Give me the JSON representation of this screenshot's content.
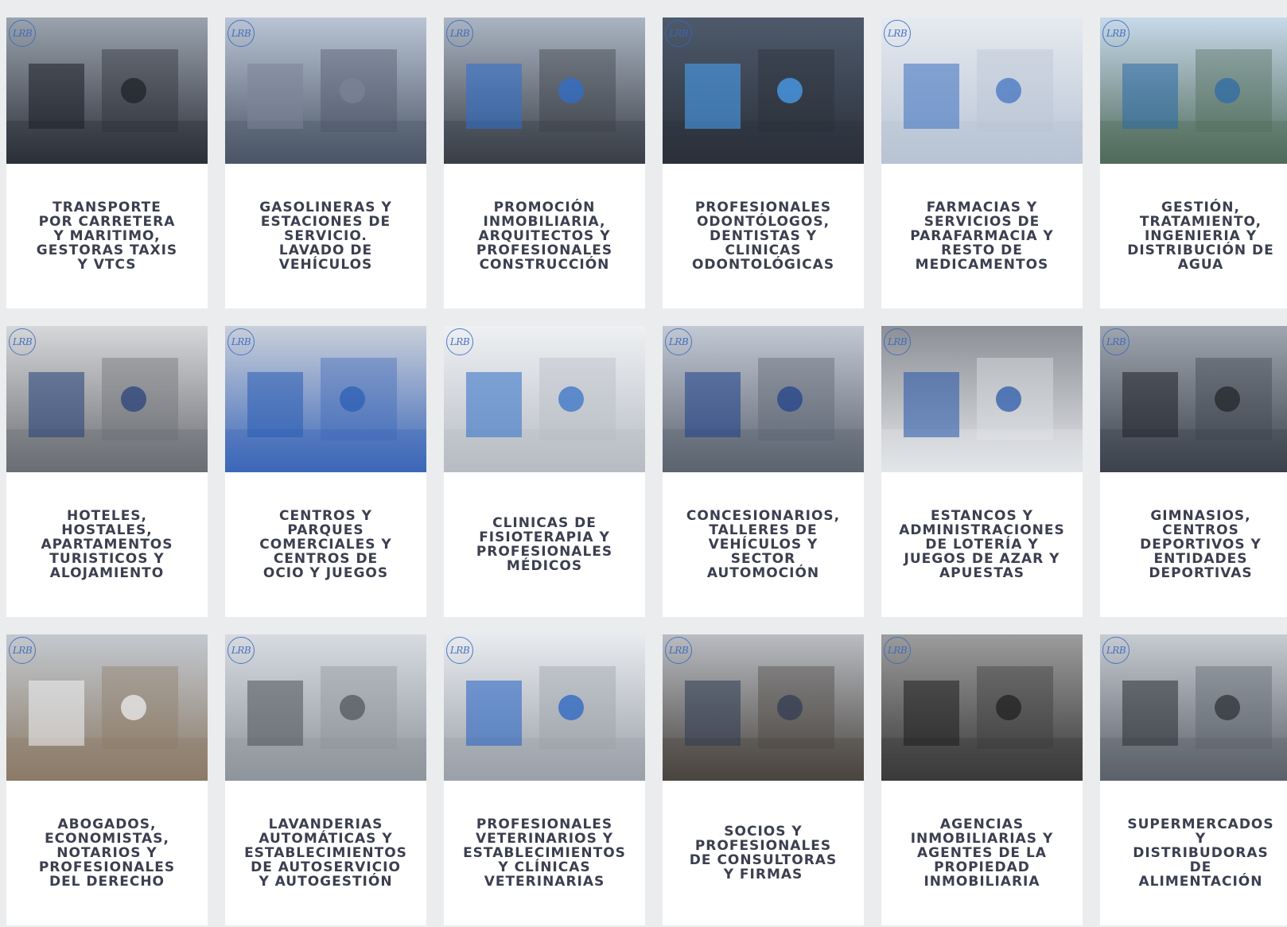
{
  "brand_mark": "LRB",
  "cards": [
    {
      "title": "TRANSPORTE\nPOR CARRETERA\nY MARITIMO,\nGESTORAS TAXIS\nY VTCS",
      "icon": "taxi-app-photo",
      "c1": "#9aa3ae",
      "c2": "#2c3038",
      "acc": "#1c1f26"
    },
    {
      "title": "GASOLINERAS Y\nESTACIONES DE\nSERVICIO.\nLAVADO DE\nVEHÍCULOS",
      "icon": "gas-station-photo",
      "c1": "#b9c4d4",
      "c2": "#4b5566",
      "acc": "#7b8597"
    },
    {
      "title": "PROMOCIÓN\nINMOBILIARIA,\nARQUITECTOS Y\nPROFESIONALES\nCONSTRUCCIÓN",
      "icon": "construction-site-photo",
      "c1": "#aab4c2",
      "c2": "#3a3f47",
      "acc": "#2d6fd0"
    },
    {
      "title": "PROFESIONALES\nODONTÓLOGOS,\nDENTISTAS Y\nCLINICAS\nODONTOLÓGICAS",
      "icon": "dental-clinic-photo",
      "c1": "#4e5a6b",
      "c2": "#2a303a",
      "acc": "#4aa8ff"
    },
    {
      "title": "FARMACIAS Y\nSERVICIOS DE\nPARAFARMACIA Y\nRESTO DE\nMEDICAMENTOS",
      "icon": "pharmacy-photo",
      "c1": "#e6eaf0",
      "c2": "#b8c4d4",
      "acc": "#3a6fbf"
    },
    {
      "title": "GESTIÓN,\nTRATAMIENTO,\nINGENIERIA Y\nDISTRIBUCIÓN DE\nAGUA",
      "icon": "water-dam-photo",
      "c1": "#c7d9ea",
      "c2": "#4f6b5a",
      "acc": "#2a6aa8"
    },
    {
      "title": "HOTELES,\nHOSTALES,\nAPARTAMENTOS\nTURISTICOS Y\nALOJAMIENTO",
      "icon": "hotel-room-photo",
      "c1": "#d6d7d9",
      "c2": "#6b6e74",
      "acc": "#243f7a"
    },
    {
      "title": "CENTROS Y\nPARQUES\nCOMERCIALES Y\nCENTROS DE\nOCIO Y JUEGOS",
      "icon": "playground-photo",
      "c1": "#c9cfda",
      "c2": "#3b67b8",
      "acc": "#2a5cb4"
    },
    {
      "title": "CLINICAS DE\nFISIOTERAPIA Y\nPROFESIONALES\nMÉDICOS",
      "icon": "physiotherapy-photo",
      "c1": "#eef0f3",
      "c2": "#b7bcc4",
      "acc": "#2e6ec8"
    },
    {
      "title": "CONCESIONARIOS,\nTALLERES DE\nVEHÍCULOS Y\nSECTOR\nAUTOMOCIÓN",
      "icon": "car-dealership-photo",
      "c1": "#c2c9d4",
      "c2": "#5c6370",
      "acc": "#1e3f8c"
    },
    {
      "title": "ESTANCOS Y\nADMINISTRACIONES\nDE LOTERÍA Y\nJUEGOS DE AZAR Y\nAPUESTAS",
      "icon": "tobacco-shop-photo",
      "c1": "#8c8f95",
      "c2": "#e3e5e9",
      "acc": "#2153a8"
    },
    {
      "title": "GIMNASIOS,\nCENTROS\nDEPORTIVOS Y\nENTIDADES\nDEPORTIVAS",
      "icon": "gym-photo",
      "c1": "#9fa6b0",
      "c2": "#3d434c",
      "acc": "#1f2329"
    },
    {
      "title": "ABOGADOS,\nECONOMISTAS,\nNOTARIOS Y\nPROFESIONALES\nDEL DERECHO",
      "icon": "office-documents-photo",
      "c1": "#c3c8cf",
      "c2": "#8b7a66",
      "acc": "#f2f4f7"
    },
    {
      "title": "LAVANDERIAS\nAUTOMÁTICAS Y\nESTABLECIMIENTOS\nDE AUTOSERVICIO\nY AUTOGESTIÓN",
      "icon": "laundromat-photo",
      "c1": "#d7dbe1",
      "c2": "#8e949c",
      "acc": "#4d5158"
    },
    {
      "title": "PROFESIONALES\nVETERINARIOS Y\nESTABLECIMIENTOS\nY CLÍNICAS\nVETERINARIAS",
      "icon": "veterinary-photo",
      "c1": "#e8ebef",
      "c2": "#9aa0a8",
      "acc": "#1f5fc4"
    },
    {
      "title": "SOCIOS Y\nPROFESIONALES\nDE CONSULTORAS\nY FIRMAS",
      "icon": "consultant-desk-photo",
      "c1": "#b9bcc2",
      "c2": "#4a4540",
      "acc": "#2e3a52"
    },
    {
      "title": "AGENCIAS\nINMOBILIARIAS Y\nAGENTES DE LA\nPROPIEDAD\nINMOBILIARIA",
      "icon": "keys-handover-photo",
      "c1": "#9c9c9c",
      "c2": "#3a3a3a",
      "acc": "#1e1e1e"
    },
    {
      "title": "SUPERMERCADOS\nY\nDISTRIBUDORAS\nDE\nALIMENTACIÓN",
      "icon": "supermarket-photo",
      "c1": "#c6cbd2",
      "c2": "#5b6169",
      "acc": "#2b2f36"
    }
  ]
}
